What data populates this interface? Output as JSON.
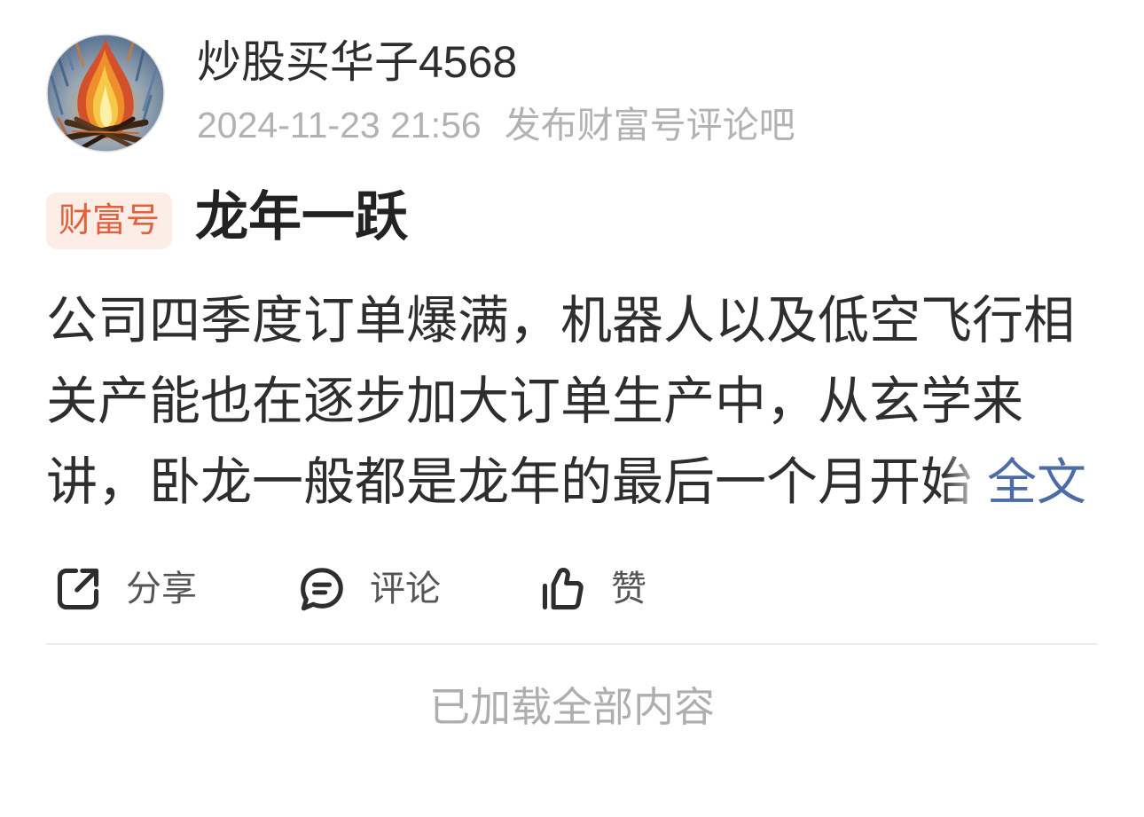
{
  "post": {
    "author": {
      "name": "炒股买华子4568"
    },
    "timestamp": "2024-11-23 21:56",
    "source": "发布财富号评论吧",
    "badge": "财富号",
    "title": "龙年一跃",
    "body": "公司四季度订单爆满，机器人以及低空飞行相关产能也在逐步加大订单生产中，从玄学来讲，卧龙一般都是龙年的最后一个月开始",
    "read_more": "全文"
  },
  "actions": [
    {
      "label": "分享",
      "icon": "share-icon"
    },
    {
      "label": "评论",
      "icon": "comment-icon"
    },
    {
      "label": "赞",
      "icon": "like-icon"
    }
  ],
  "footer": {
    "status": "已加载全部内容"
  },
  "colors": {
    "text_primary": "#2e2e2e",
    "text_secondary": "#555555",
    "text_muted": "#b2b2b2",
    "badge_bg": "#fdede7",
    "badge_text": "#e4603a",
    "link": "#4b6ca7",
    "divider": "#ececec",
    "footer_text": "#aeaeae"
  }
}
